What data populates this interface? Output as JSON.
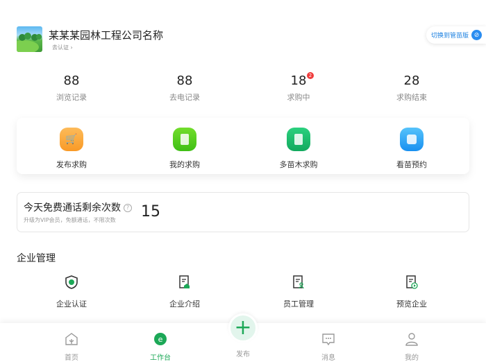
{
  "header": {
    "company_name": "某某某园林工程公司名称",
    "verify_link": "去认证 ›",
    "switch_button": "切换到管苗版"
  },
  "stats": [
    {
      "value": "88",
      "label": "浏览记录"
    },
    {
      "value": "88",
      "label": "去电记录"
    },
    {
      "value": "18",
      "label": "求购中",
      "badge": "2"
    },
    {
      "value": "28",
      "label": "求购结束"
    }
  ],
  "quick_actions": [
    {
      "label": "发布求购",
      "color": "#fba63c"
    },
    {
      "label": "我的求购",
      "color": "#4fcc1e"
    },
    {
      "label": "多苗木求购",
      "color": "#17b96a"
    },
    {
      "label": "看苗预约",
      "color": "#2a9df4"
    }
  ],
  "calls": {
    "title": "今天免费通话剩余次数",
    "help": "?",
    "subtitle": "升级为VIP会员，免额通话，不限次数",
    "remaining": "15"
  },
  "management": {
    "heading": "企业管理",
    "items": [
      {
        "label": "企业认证"
      },
      {
        "label": "企业介绍"
      },
      {
        "label": "员工管理"
      },
      {
        "label": "预览企业"
      }
    ]
  },
  "nav": {
    "items": [
      {
        "label": "首页"
      },
      {
        "label": "工作台"
      },
      {
        "label": "发布"
      },
      {
        "label": "消息"
      },
      {
        "label": "我的"
      }
    ],
    "active": "工作台",
    "accent": "#1ca857"
  }
}
